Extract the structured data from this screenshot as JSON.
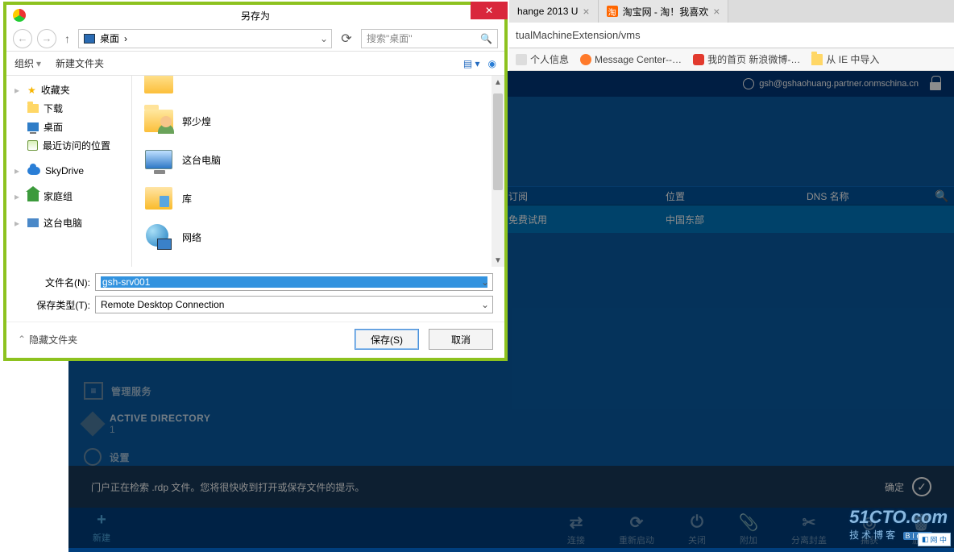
{
  "browser": {
    "tabs": [
      {
        "label": "hange 2013 U"
      },
      {
        "label": "淘宝网 - 淘！我喜欢",
        "favicon_text": "淘"
      }
    ],
    "address": "tualMachineExtension/vms",
    "bookmarks": {
      "b1": "个人信息",
      "b2": "Message Center--…",
      "b3": "我的首页 新浪微博-…",
      "b4": "从 IE 中导入"
    }
  },
  "portal": {
    "user_email": "gsh@gshaohuang.partner.onmschina.cn",
    "table": {
      "headers": {
        "c1": "订阅",
        "c2": "位置",
        "c3": "DNS 名称"
      },
      "row": {
        "c1": "免费试用",
        "c2": "中国东部",
        "c3": " "
      }
    },
    "left_nav": {
      "item1": "管理服务",
      "item2": "ACTIVE DIRECTORY",
      "item2_sub": "1",
      "item3": "设置"
    },
    "notif_text": "门户正在检索 .rdp 文件。您将很快收到打开或保存文件的提示。",
    "notif_ok": "确定",
    "cmds": {
      "new": "新建",
      "connect": "连接",
      "restart": "重新启动",
      "shutdown": "关闭",
      "attach": "附加",
      "detach": "分离封盖",
      "capture": "捕获",
      "delete": "删除"
    }
  },
  "dialog": {
    "title": "另存为",
    "path_label": "桌面",
    "path_sep": "›",
    "search_placeholder": "搜索\"桌面\"",
    "toolbar": {
      "organize": "组织",
      "newfolder": "新建文件夹"
    },
    "sidebar": {
      "favorites": "收藏夹",
      "downloads": "下载",
      "desktop": "桌面",
      "recent": "最近访问的位置",
      "skydrive": "SkyDrive",
      "homegroup": "家庭组",
      "thispc": "这台电脑"
    },
    "files": {
      "item0": "",
      "item1": "郭少煌",
      "item2": "这台电脑",
      "item3": "库",
      "item4": "网络"
    },
    "filename_label": "文件名(N):",
    "filetype_label": "保存类型(T):",
    "filename_value": "gsh-srv001",
    "filetype_value": "Remote Desktop Connection",
    "hide_folders": "隐藏文件夹",
    "save_btn": "保存(S)",
    "cancel_btn": "取消"
  },
  "watermark": {
    "main": "51CTO.com",
    "sub": "技术博客",
    "badge": "Blog",
    "corner": "网 中"
  }
}
